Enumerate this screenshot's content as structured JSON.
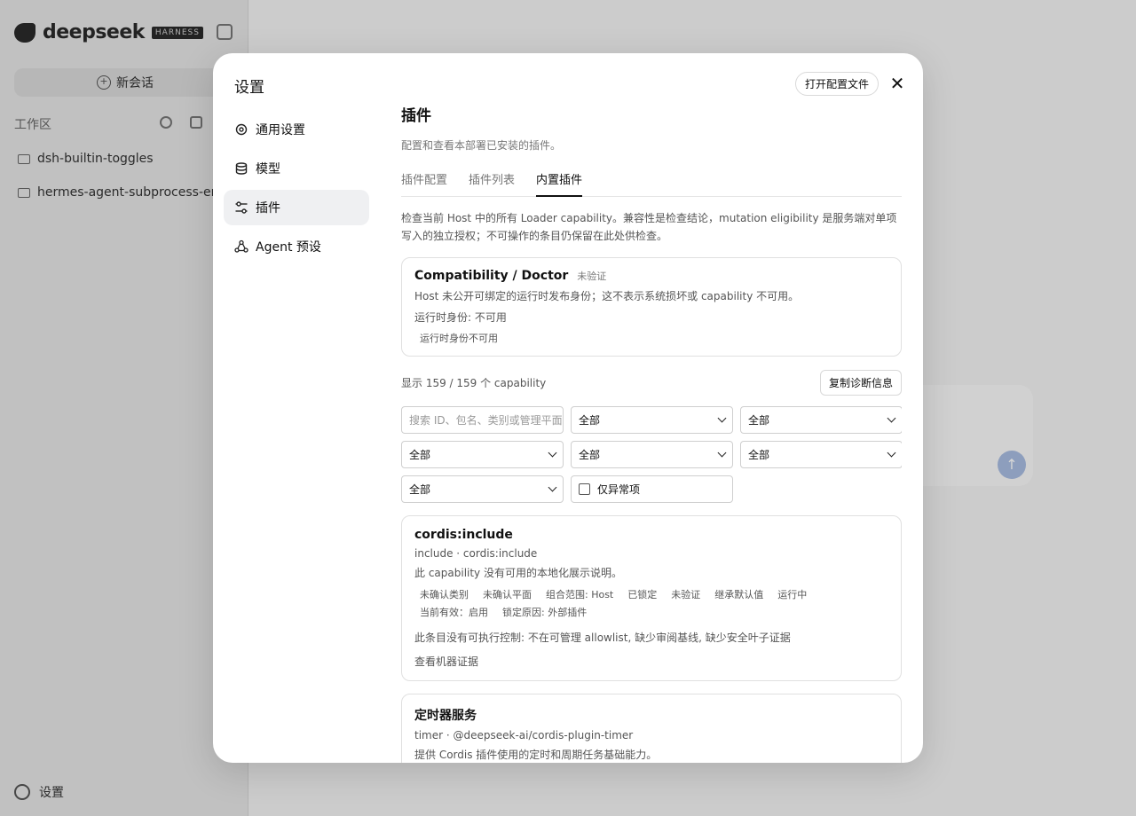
{
  "app": {
    "logo_text": "deepseek",
    "logo_badge": "HARNESS",
    "new_chat_label": "新会话",
    "workspace_label": "工作区",
    "folders": [
      "dsh-builtin-toggles",
      "hermes-agent-subprocess-end"
    ],
    "settings_label": "设置"
  },
  "modal": {
    "title": "设置",
    "open_config_label": "打开配置文件",
    "close_glyph": "✕",
    "nav": [
      {
        "label": "通用设置",
        "icon": "gear-icon"
      },
      {
        "label": "模型",
        "icon": "database-icon"
      },
      {
        "label": "插件",
        "icon": "sliders-icon"
      },
      {
        "label": "Agent 预设",
        "icon": "agent-icon"
      }
    ]
  },
  "plugins": {
    "title": "插件",
    "subtitle": "配置和查看本部署已安装的插件。",
    "tabs": [
      "插件配置",
      "插件列表",
      "内置插件"
    ],
    "active_tab": "内置插件",
    "description": "检查当前 Host 中的所有 Loader capability。兼容性是检查结论，mutation eligibility 是服务端对单项写入的独立授权；不可操作的条目仍保留在此处供检查。",
    "doctor": {
      "title": "Compatibility / Doctor",
      "badge": "未验证",
      "line1": "Host 未公开可绑定的运行时发布身份；这不表示系统损坏或 capability 不可用。",
      "line2": "运行时身份: 不可用",
      "line3": "运行时身份不可用"
    },
    "count_text": "显示 159 / 159 个 capability",
    "copy_label": "复制诊断信息",
    "search_placeholder": "搜索 ID、包名、类别或管理平面",
    "filter_all": "全部",
    "anomaly_only_label": "仅异常项",
    "capabilities": [
      {
        "title": "cordis:include",
        "meta": "include · cordis:include",
        "desc": "此 capability 没有可用的本地化展示说明。",
        "chips": [
          "未确认类别",
          "未确认平面",
          "组合范围: Host",
          "已锁定",
          "未验证",
          "继承默认值",
          "运行中",
          "当前有效：启用",
          "锁定原因: 外部插件"
        ],
        "control": "此条目没有可执行控制: 不在可管理 allowlist, 缺少审阅基线, 缺少安全叶子证据",
        "link": "查看机器证据"
      },
      {
        "title": "定时器服务",
        "meta": "timer · @deepseek-ai/cordis-plugin-timer",
        "desc": "提供 Cordis 插件使用的定时和周期任务基础能力。"
      }
    ]
  },
  "colors": {
    "accent": "#111111",
    "muted": "#777777",
    "send_button": "#a9bde2"
  }
}
